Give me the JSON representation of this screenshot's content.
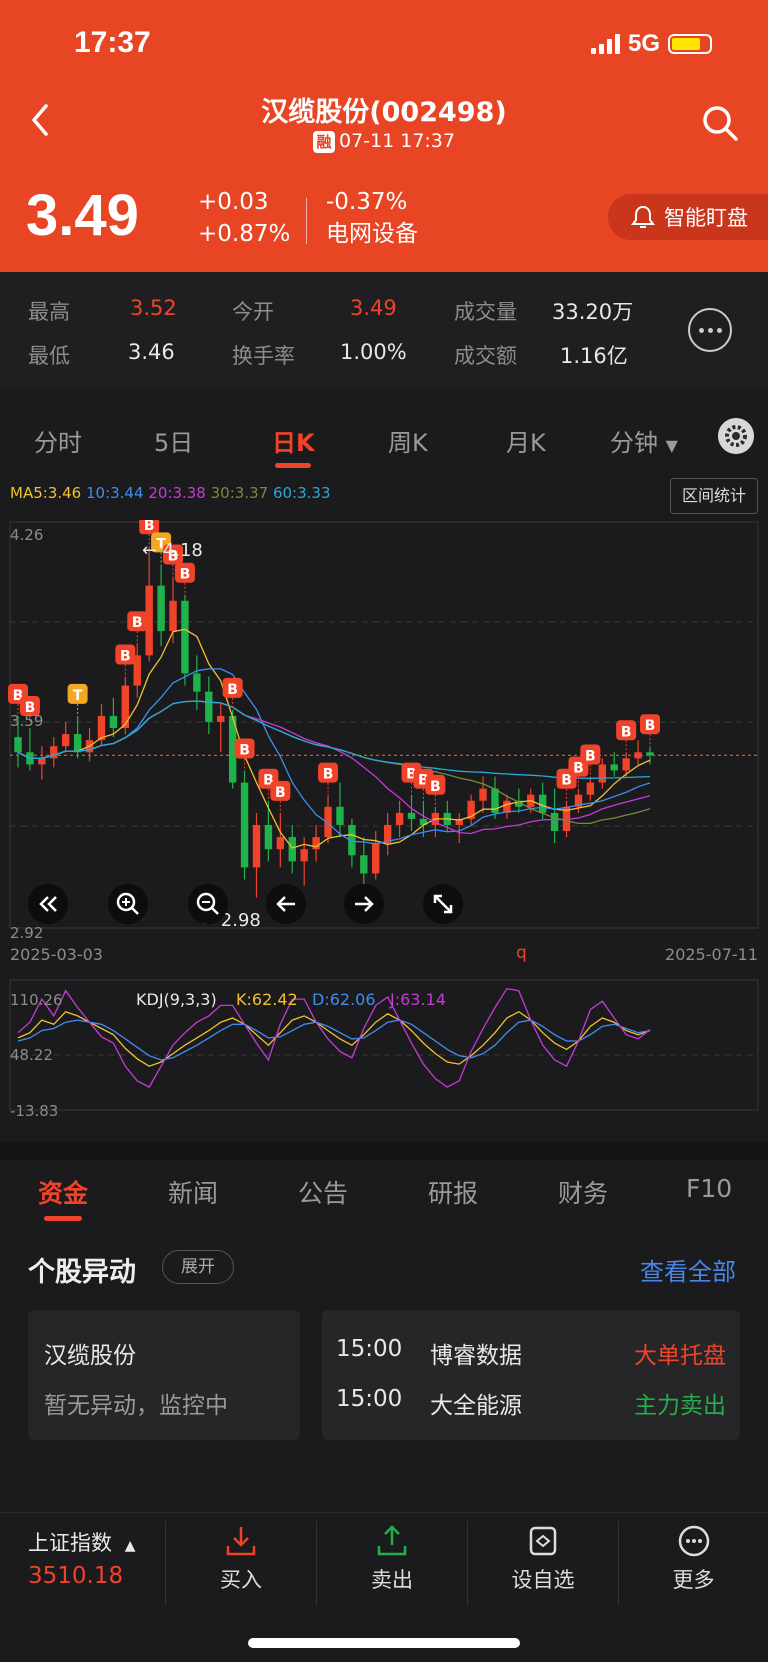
{
  "status": {
    "time": "17:37",
    "network": "5G"
  },
  "header": {
    "title": "汉缆股份(002498)",
    "rong_badge": "融",
    "timestamp": "07-11 17:37",
    "price": "3.49",
    "change_abs": "+0.03",
    "change_pct_a": "+0.87%",
    "change_pct_b": "-0.37%",
    "sector": "电网设备",
    "watch_label": "智能盯盘"
  },
  "stats": {
    "high_label": "最高",
    "high": "3.52",
    "open_label": "今开",
    "open": "3.49",
    "volume_label": "成交量",
    "volume": "33.20万",
    "low_label": "最低",
    "low": "3.46",
    "turnover_label": "换手率",
    "turnover": "1.00%",
    "amount_label": "成交额",
    "amount": "1.16亿"
  },
  "tabs": [
    {
      "label": "分时"
    },
    {
      "label": "5日"
    },
    {
      "label": "日K"
    },
    {
      "label": "周K"
    },
    {
      "label": "月K"
    },
    {
      "label": "分钟"
    }
  ],
  "ma_legend": [
    {
      "text": "MA5:3.46",
      "color": "#f2c12e"
    },
    {
      "text": "10:3.44",
      "color": "#3d8ef0"
    },
    {
      "text": "20:3.38",
      "color": "#c63ad6"
    },
    {
      "text": "30:3.37",
      "color": "#6f8f3a"
    },
    {
      "text": "60:3.33",
      "color": "#2aa8d8"
    }
  ],
  "range_stats_label": "区间统计",
  "chart_data": {
    "type": "candlestick",
    "y_top": "4.26",
    "y_mid": "3.59",
    "y_bottom": "2.92",
    "ylim": [
      2.92,
      4.26
    ],
    "start_date": "2025-03-03",
    "end_date": "2025-07-11",
    "max_label": "4.18",
    "min_label": "2.98",
    "mid_marker": "q",
    "ohlc": [
      [
        3.55,
        3.62,
        3.45,
        3.5
      ],
      [
        3.5,
        3.58,
        3.44,
        3.46
      ],
      [
        3.46,
        3.52,
        3.41,
        3.48
      ],
      [
        3.48,
        3.55,
        3.45,
        3.52
      ],
      [
        3.52,
        3.6,
        3.5,
        3.56
      ],
      [
        3.56,
        3.62,
        3.48,
        3.5
      ],
      [
        3.5,
        3.58,
        3.47,
        3.54
      ],
      [
        3.54,
        3.66,
        3.52,
        3.62
      ],
      [
        3.62,
        3.68,
        3.55,
        3.58
      ],
      [
        3.58,
        3.75,
        3.56,
        3.72
      ],
      [
        3.72,
        3.86,
        3.68,
        3.82
      ],
      [
        3.82,
        4.18,
        3.8,
        4.05
      ],
      [
        4.05,
        4.12,
        3.85,
        3.9
      ],
      [
        3.9,
        4.08,
        3.86,
        4.0
      ],
      [
        4.0,
        4.02,
        3.72,
        3.76
      ],
      [
        3.76,
        3.82,
        3.64,
        3.7
      ],
      [
        3.7,
        3.75,
        3.56,
        3.6
      ],
      [
        3.6,
        3.66,
        3.5,
        3.62
      ],
      [
        3.62,
        3.64,
        3.38,
        3.4
      ],
      [
        3.4,
        3.44,
        3.08,
        3.12
      ],
      [
        3.12,
        3.3,
        3.02,
        3.26
      ],
      [
        3.26,
        3.34,
        3.14,
        3.18
      ],
      [
        3.18,
        3.3,
        3.12,
        3.22
      ],
      [
        3.22,
        3.26,
        3.1,
        3.14
      ],
      [
        3.14,
        3.22,
        3.06,
        3.18
      ],
      [
        3.18,
        3.26,
        3.14,
        3.22
      ],
      [
        3.22,
        3.36,
        3.2,
        3.32
      ],
      [
        3.32,
        3.4,
        3.22,
        3.26
      ],
      [
        3.26,
        3.28,
        3.12,
        3.16
      ],
      [
        3.16,
        3.22,
        3.06,
        3.1
      ],
      [
        3.1,
        3.24,
        3.08,
        3.2
      ],
      [
        3.2,
        3.3,
        3.16,
        3.26
      ],
      [
        3.26,
        3.34,
        3.22,
        3.3
      ],
      [
        3.3,
        3.36,
        3.24,
        3.28
      ],
      [
        3.28,
        3.34,
        3.22,
        3.26
      ],
      [
        3.26,
        3.32,
        3.22,
        3.3
      ],
      [
        3.3,
        3.34,
        3.24,
        3.26
      ],
      [
        3.26,
        3.3,
        3.2,
        3.28
      ],
      [
        3.28,
        3.36,
        3.26,
        3.34
      ],
      [
        3.34,
        3.42,
        3.3,
        3.38
      ],
      [
        3.38,
        3.42,
        3.28,
        3.3
      ],
      [
        3.3,
        3.36,
        3.28,
        3.34
      ],
      [
        3.34,
        3.38,
        3.3,
        3.32
      ],
      [
        3.32,
        3.38,
        3.3,
        3.36
      ],
      [
        3.36,
        3.4,
        3.28,
        3.3
      ],
      [
        3.3,
        3.38,
        3.2,
        3.24
      ],
      [
        3.24,
        3.34,
        3.22,
        3.32
      ],
      [
        3.32,
        3.38,
        3.3,
        3.36
      ],
      [
        3.36,
        3.42,
        3.34,
        3.4
      ],
      [
        3.4,
        3.48,
        3.38,
        3.46
      ],
      [
        3.46,
        3.5,
        3.42,
        3.44
      ],
      [
        3.44,
        3.5,
        3.42,
        3.48
      ],
      [
        3.48,
        3.54,
        3.46,
        3.5
      ],
      [
        3.5,
        3.52,
        3.46,
        3.49
      ]
    ],
    "kdj": {
      "label": "KDJ(9,3,3)",
      "k": "K:62.42",
      "d": "D:62.06",
      "j": "J:63.14",
      "y_top": "110.26",
      "y_mid": "48.22",
      "y_bottom": "-13.83",
      "k_values": [
        55,
        60,
        72,
        68,
        80,
        76,
        70,
        64,
        58,
        45,
        35,
        28,
        32,
        40,
        48,
        55,
        62,
        70,
        74,
        68,
        58,
        48,
        60,
        72,
        76,
        70,
        62,
        54,
        48,
        58,
        70,
        78,
        72,
        62,
        50,
        40,
        32,
        30,
        38,
        48,
        60,
        74,
        80,
        72,
        60,
        50,
        44,
        52,
        66,
        74,
        70,
        62,
        58,
        62
      ],
      "d_values": [
        52,
        55,
        62,
        64,
        70,
        72,
        70,
        68,
        62,
        54,
        46,
        38,
        34,
        36,
        42,
        48,
        55,
        62,
        68,
        68,
        62,
        55,
        56,
        62,
        68,
        70,
        66,
        60,
        54,
        55,
        62,
        70,
        72,
        68,
        60,
        52,
        44,
        38,
        36,
        40,
        48,
        60,
        70,
        72,
        66,
        58,
        52,
        52,
        58,
        66,
        68,
        64,
        60,
        62
      ],
      "j_values": [
        60,
        70,
        92,
        76,
        100,
        84,
        70,
        56,
        50,
        28,
        14,
        8,
        28,
        48,
        60,
        70,
        76,
        86,
        86,
        68,
        50,
        34,
        68,
        92,
        92,
        70,
        54,
        42,
        36,
        64,
        86,
        94,
        72,
        50,
        30,
        16,
        8,
        14,
        42,
        64,
        84,
        102,
        100,
        72,
        48,
        34,
        28,
        52,
        82,
        90,
        74,
        58,
        54,
        63
      ]
    }
  },
  "nav_controls": [
    "«",
    "zoom-in",
    "zoom-out",
    "←",
    "→",
    "expand"
  ],
  "section2": {
    "tabs": [
      {
        "label": "资金"
      },
      {
        "label": "新闻"
      },
      {
        "label": "公告"
      },
      {
        "label": "研报"
      },
      {
        "label": "财务"
      },
      {
        "label": "F10"
      }
    ],
    "title": "个股异动",
    "expand_label": "展开",
    "view_all": "查看全部",
    "stock_card": {
      "name": "汉缆股份",
      "status": "暂无异动，监控中"
    },
    "alerts": [
      {
        "time": "15:00",
        "name": "博睿数据",
        "tag": "大单托盘",
        "tag_color": "#f0432a"
      },
      {
        "time": "15:00",
        "name": "大全能源",
        "tag": "主力卖出",
        "tag_color": "#23b04a"
      }
    ]
  },
  "bottom": {
    "index_name": "上证指数",
    "index_value": "3510.18",
    "buttons": [
      {
        "label": "买入"
      },
      {
        "label": "卖出"
      },
      {
        "label": "设自选"
      },
      {
        "label": "更多"
      }
    ]
  }
}
